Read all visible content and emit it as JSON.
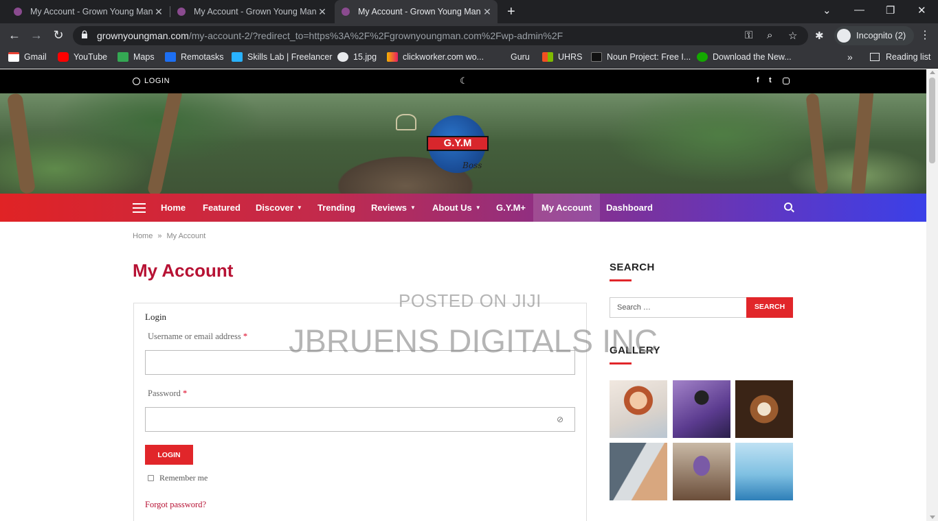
{
  "browser": {
    "tabs": [
      {
        "title": "My Account - Grown Young Man",
        "active": false
      },
      {
        "title": "My Account - Grown Young Man",
        "active": false
      },
      {
        "title": "My Account - Grown Young Man",
        "active": true
      }
    ],
    "url_host": "grownyoungman.com",
    "url_path": "/my-account-2/?redirect_to=https%3A%2F%2Fgrownyoungman.com%2Fwp-admin%2F",
    "profile_label": "Incognito (2)",
    "bookmarks": [
      "Gmail",
      "YouTube",
      "Maps",
      "Remotasks",
      "Skills Lab | Freelancer",
      "15.jpg",
      "clickworker.com wo...",
      "Guru",
      "UHRS",
      "Noun Project: Free I...",
      "Download the New..."
    ],
    "reading_list": "Reading list"
  },
  "site": {
    "topbar": {
      "login": "LOGIN"
    },
    "logo_text": "G.Y.M",
    "logo_signature": "Boss",
    "nav": [
      {
        "label": "Home",
        "dropdown": false,
        "active": false
      },
      {
        "label": "Featured",
        "dropdown": false,
        "active": false
      },
      {
        "label": "Discover",
        "dropdown": true,
        "active": false
      },
      {
        "label": "Trending",
        "dropdown": false,
        "active": false
      },
      {
        "label": "Reviews",
        "dropdown": true,
        "active": false
      },
      {
        "label": "About Us",
        "dropdown": true,
        "active": false
      },
      {
        "label": "G.Y.M+",
        "dropdown": false,
        "active": false
      },
      {
        "label": "My Account",
        "dropdown": false,
        "active": true
      },
      {
        "label": "Dashboard",
        "dropdown": false,
        "active": false
      }
    ],
    "breadcrumb": {
      "home": "Home",
      "separator": "»",
      "current": "My Account"
    },
    "page_title": "My Account",
    "login_form": {
      "heading": "Login",
      "username_label": "Username or email address",
      "password_label": "Password",
      "required_mark": "*",
      "submit": "LOGIN",
      "remember": "Remember me",
      "forgot": "Forgot password?"
    },
    "sidebar": {
      "search_title": "SEARCH",
      "search_placeholder": "Search …",
      "search_button": "SEARCH",
      "gallery_title": "GALLERY",
      "gallery_count": 6
    },
    "watermark": {
      "line1": "POSTED ON JIJI",
      "line2": "JBRUENS DIGITALS INC"
    }
  },
  "colors": {
    "accent": "#e1262a",
    "title": "#b71234",
    "nav_start": "#e02325",
    "nav_end": "#3a40e8"
  }
}
